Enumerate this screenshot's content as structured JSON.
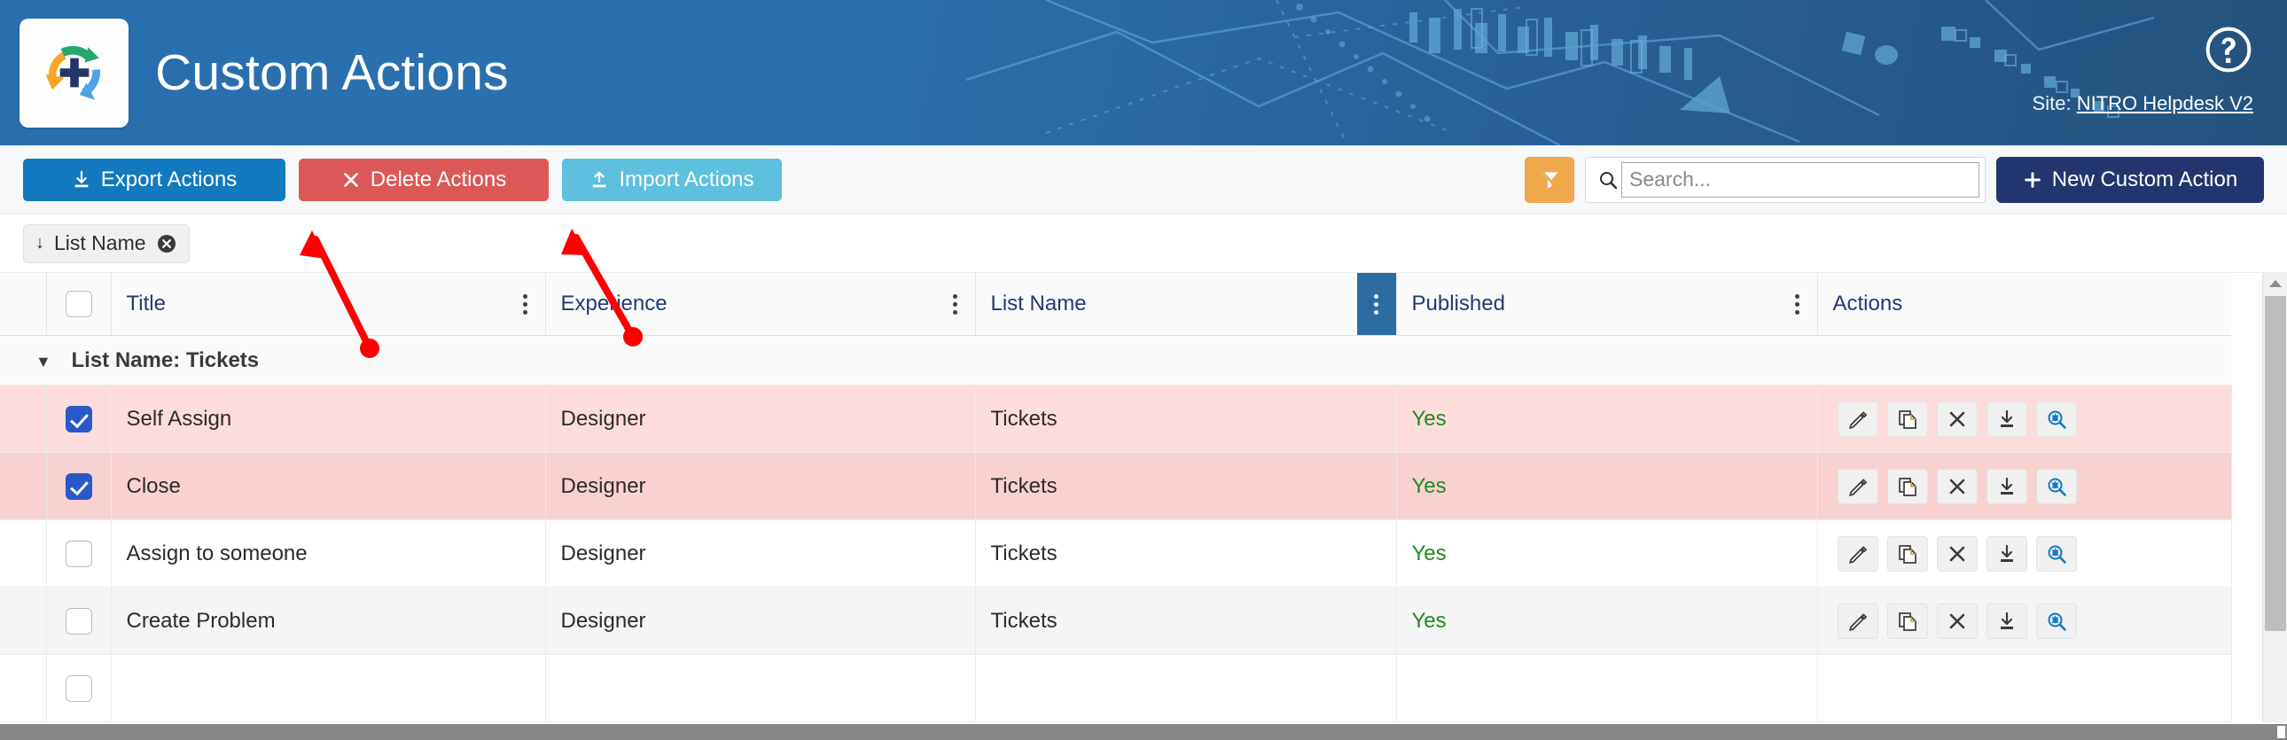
{
  "header": {
    "title": "Custom Actions",
    "logo_icon": "nitro-custom-actions-logo",
    "help_icon": "help-circle-icon",
    "site_prefix": "Site:",
    "site_name": "NITRO Helpdesk V2",
    "bg_color": "#2a6fad"
  },
  "toolbar": {
    "export_label": "Export Actions",
    "export_icon": "download-icon",
    "export_color": "#1279be",
    "delete_label": "Delete Actions",
    "delete_icon": "close-x-icon",
    "delete_color": "#dc5856",
    "import_label": "Import Actions",
    "import_icon": "upload-icon",
    "import_color": "#5dc0de",
    "filter_icon": "clear-filter-icon",
    "filter_color": "#efa84c",
    "search_icon": "search-icon",
    "search_placeholder": "Search...",
    "search_value": "",
    "new_label": "New Custom Action",
    "new_icon": "plus-icon",
    "new_color": "#22356f"
  },
  "sort_chip": {
    "arrow": "↓",
    "label": "List Name",
    "remove_icon": "circle-x-icon"
  },
  "grid": {
    "columns": [
      {
        "key": "handle",
        "label": ""
      },
      {
        "key": "check",
        "label": ""
      },
      {
        "key": "title",
        "label": "Title",
        "menu_icon": "kebab-menu-icon",
        "menu_active": false
      },
      {
        "key": "experience",
        "label": "Experience",
        "menu_icon": "kebab-menu-icon",
        "menu_active": false
      },
      {
        "key": "list_name",
        "label": "List Name",
        "menu_icon": "kebab-menu-icon",
        "menu_active": true
      },
      {
        "key": "published",
        "label": "Published",
        "menu_icon": "kebab-menu-icon",
        "menu_active": false
      },
      {
        "key": "actions",
        "label": "Actions",
        "menu_icon": "",
        "menu_active": false
      }
    ],
    "group_header": "List Name: Tickets",
    "group_caret": "▼",
    "header_select_all_checked": false,
    "row_action_icons": [
      "edit-pencil-icon",
      "copy-icon",
      "delete-x-icon",
      "download-icon",
      "debug-search-icon"
    ],
    "rows": [
      {
        "selected": true,
        "title": "Self Assign",
        "experience": "Designer",
        "list_name": "Tickets",
        "published": "Yes"
      },
      {
        "selected": true,
        "title": "Close",
        "experience": "Designer",
        "list_name": "Tickets",
        "published": "Yes"
      },
      {
        "selected": false,
        "title": "Assign to someone",
        "experience": "Designer",
        "list_name": "Tickets",
        "published": "Yes"
      },
      {
        "selected": false,
        "title": "Create Problem",
        "experience": "Designer",
        "list_name": "Tickets",
        "published": "Yes"
      },
      {
        "selected": false,
        "title": "",
        "experience": "",
        "list_name": "",
        "published": ""
      }
    ],
    "published_yes_color": "#1f8a1f",
    "selected_row_color": "#fcdddc"
  },
  "annotations": [
    {
      "name": "arrow-to-export-actions",
      "color": "#ff0000"
    },
    {
      "name": "arrow-to-delete-actions",
      "color": "#ff0000"
    }
  ],
  "scrollbars": {
    "vertical_up_arrow": "scroll-up-arrow-icon",
    "horizontal": "horizontal-scrollbar"
  }
}
